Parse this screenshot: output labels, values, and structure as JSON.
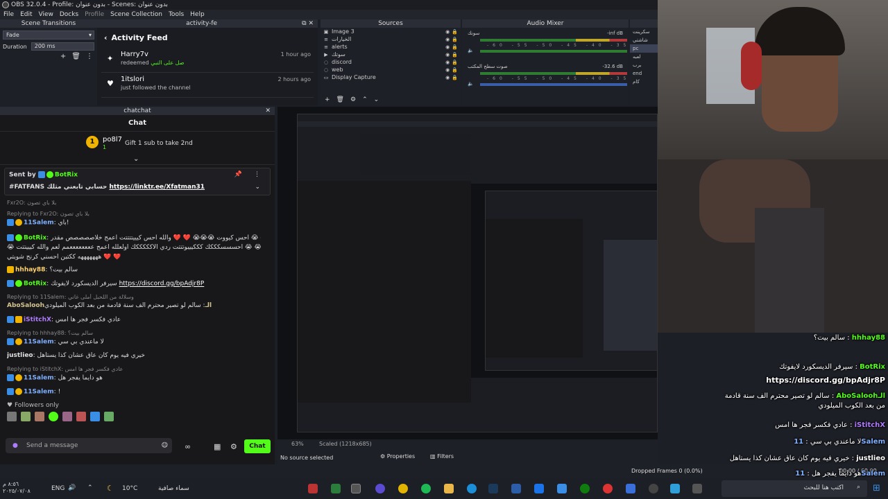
{
  "window": {
    "title": "OBS 32.0.4 - Profile: بدون عنوان - Scenes: بدون عنوان"
  },
  "menu": [
    "File",
    "Edit",
    "View",
    "Docks",
    "Profile",
    "Scene Collection",
    "Tools",
    "Help"
  ],
  "scene_transitions": {
    "title": "Scene Transitions",
    "selected": "Fade",
    "duration_label": "Duration",
    "duration_value": "200 ms"
  },
  "activity_feed": {
    "dock_title": "activity-fe",
    "title": "Activity Feed",
    "items": [
      {
        "name": "Harry7v",
        "action": "redeemed",
        "reward": "صل على النبي",
        "time": "1 hour ago"
      },
      {
        "name": "1itslori",
        "action": "just followed the channel",
        "time": "2 hours ago"
      }
    ]
  },
  "sources": {
    "title": "Sources",
    "items": [
      "Image 3",
      "الخيارات",
      "alerts",
      "سوتك",
      "discord",
      "web",
      "Display Capture"
    ]
  },
  "audio_mixer": {
    "title": "Audio Mixer",
    "channels": [
      {
        "name": "سونك",
        "level": "-inf dB"
      },
      {
        "name": "صوت سطح المكتب",
        "level": "-32.6 dB"
      }
    ],
    "scale": "-60 -55 -50 -45 -40 -35 -30 -25 -20 -15 -10 -5 0"
  },
  "scenes": {
    "items": [
      "سكرينت",
      "شاشتي",
      "pc",
      "لعبه",
      "برب",
      "end",
      "كام"
    ],
    "selected": 2
  },
  "chat": {
    "dock_title": "chatchat",
    "title": "Chat",
    "gift": {
      "user": "po8l7",
      "count": "1",
      "text": "Gift 1 sub to take 2nd"
    },
    "pinned": {
      "sent_by": "Sent by",
      "bot": "BotRix",
      "text": "#FATFANS حسابي تابعني مثلك",
      "link": "https://linktr.ee/Xfatman31"
    },
    "messages": [
      {
        "reply": "Fxr2O: بلا باي تصون",
        "user": "",
        "text": ""
      },
      {
        "reply": "Replying to Fxr2O:  بلا باي تصون",
        "user": "11Salem",
        "text": "باي!"
      },
      {
        "reply": "",
        "user": "BotRix",
        "text": "احس كيووت 😭😭😭 ❤️ ❤️ والله احس كيييتتتتت اعمج خلاصصصصص مقدر 😭 😭"
      },
      {
        "reply": "",
        "user": "",
        "text": "😭 احسسسكككك كككيييوتتتت ردي الاكككككك اولعلله اعمج ععععععععمم لعم والله كيييتتت 😭 😭"
      },
      {
        "reply": "",
        "user": "",
        "text": "هههههههه ككتين احسني كرنج شويتي ❤️ ❤️"
      },
      {
        "reply": "",
        "user": "hhhay88",
        "text": "سالم بيت؟"
      },
      {
        "reply": "",
        "user": "BotRix",
        "text": "سيرفر الديسكورد لايفوتك",
        "link": "https://discord.gg/bpAdjr8P"
      },
      {
        "reply": "Replying to 11Salem: وسلالة من اللحبل أملى غاني",
        "user": "AboSaloohالـ",
        "text": "سالم لو تصير محترم الف سنة قادمة من بعد الكوب الميلودي"
      },
      {
        "reply": "",
        "user": "iStitchX",
        "text": "عادي فكسر فجر ها امس"
      },
      {
        "reply": "Replying to hhhay88:  سالم بيت؟",
        "user": "11Salem",
        "text": "لا ماعندي بي سي"
      },
      {
        "reply": "",
        "user": "justlieo",
        "text": "خيري فيه يوم كان عاق عشان كذا يستاهل"
      },
      {
        "reply": "Replying to iStitchX:  عادي فكسر فجر ها امس",
        "user": "11Salem",
        "text": "هو دايماً يفجر هل"
      },
      {
        "reply": "",
        "user": "11Salem",
        "text": "!"
      }
    ],
    "followers_only": "Followers only",
    "input_placeholder": "Send a message",
    "send_label": "Chat"
  },
  "preview": {
    "zoom": "63%",
    "scaled": "Scaled (1218x685)",
    "no_source": "No source selected",
    "properties": "Properties",
    "filters": "Filters"
  },
  "status": {
    "dropped_frames": "Dropped Frames 0 (0.0%)",
    "fps": "00:00 / 60.00 FPS"
  },
  "taskbar": {
    "weather_text": "سماء صافية",
    "temperature": "10°C",
    "language": "ENG",
    "time": "٨:٥٦ م",
    "date": "٢٠٢٥/٠٧/٠٨",
    "search_placeholder": "اكتب هنا للبحث"
  },
  "overlay_chat": [
    {
      "user": "hhhay88",
      "text": "سالم بيت؟"
    },
    {
      "user": "BotRix",
      "text": "سيرفر الديسكورد لايفوتك"
    },
    {
      "user": "",
      "text": "https://discord.gg/bpAdjr8P"
    },
    {
      "user": "AboSaloohالـ",
      "text": "سالم لو تصير محترم الف سنة قادمة"
    },
    {
      "user": "",
      "text": "من بعد الكوب الميلودي"
    },
    {
      "user": "iStitchX",
      "text": "عادي فكسر فجر ها امس"
    },
    {
      "user": "11Salem",
      "text": "لا ماعندي بي سي"
    },
    {
      "user": "justlieo",
      "text": "خيري فيه يوم كان عاق عشان كذا يستاهل"
    },
    {
      "user": "11Salem",
      "text": "هو دايماً يفجر هل"
    }
  ],
  "colors": {
    "kick_green": "#53fc18",
    "bg": "#1d1f26"
  }
}
